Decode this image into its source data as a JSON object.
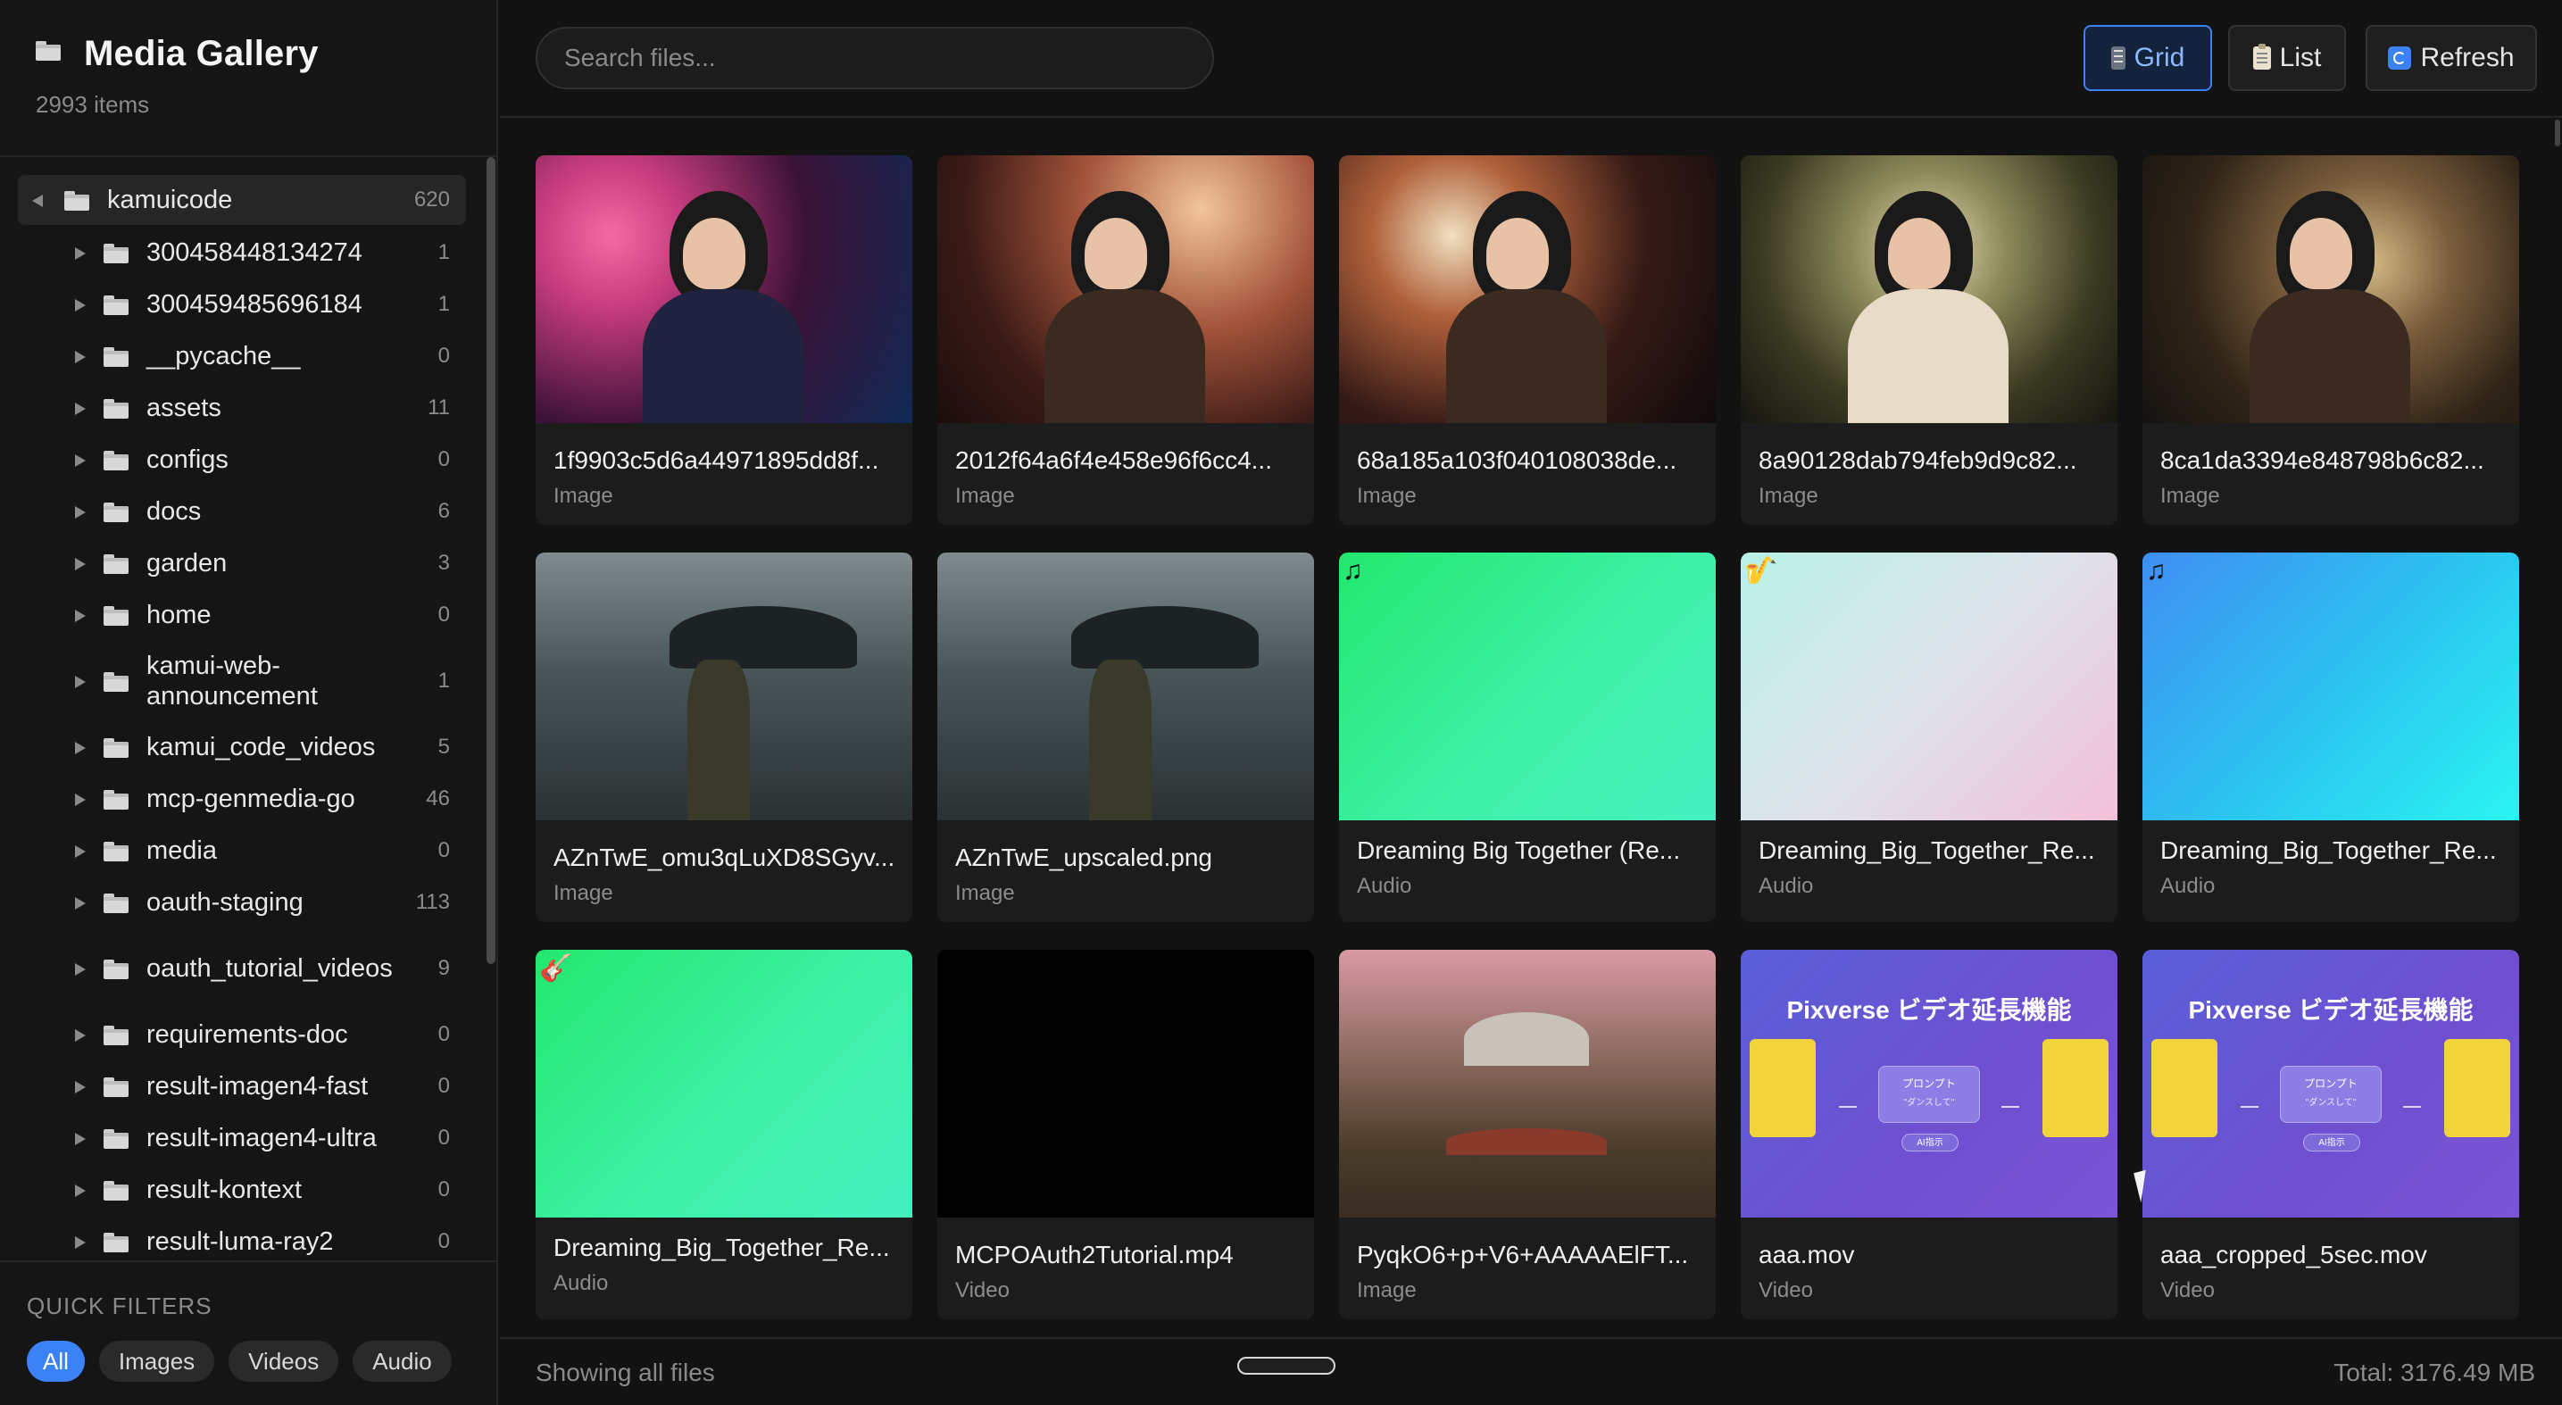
{
  "sidebar": {
    "title": "Media Gallery",
    "item_count": "2993 items",
    "root": {
      "name": "kamuicode",
      "count": "620"
    },
    "folders": [
      {
        "name": "300458448134274",
        "count": "1"
      },
      {
        "name": "300459485696184",
        "count": "1"
      },
      {
        "name": "__pycache__",
        "count": "0"
      },
      {
        "name": "assets",
        "count": "11"
      },
      {
        "name": "configs",
        "count": "0"
      },
      {
        "name": "docs",
        "count": "6"
      },
      {
        "name": "garden",
        "count": "3"
      },
      {
        "name": "home",
        "count": "0"
      },
      {
        "name": "kamui-web-announcement",
        "count": "1"
      },
      {
        "name": "kamui_code_videos",
        "count": "5"
      },
      {
        "name": "mcp-genmedia-go",
        "count": "46"
      },
      {
        "name": "media",
        "count": "0"
      },
      {
        "name": "oauth-staging",
        "count": "113"
      },
      {
        "name": "oauth_tutorial_videos",
        "count": "9"
      },
      {
        "name": "requirements-doc",
        "count": "0"
      },
      {
        "name": "result-imagen4-fast",
        "count": "0"
      },
      {
        "name": "result-imagen4-ultra",
        "count": "0"
      },
      {
        "name": "result-kontext",
        "count": "0"
      },
      {
        "name": "result-luma-ray2",
        "count": "0"
      }
    ],
    "quick_filters": {
      "heading": "QUICK FILTERS",
      "chips": [
        "All",
        "Images",
        "Videos",
        "Audio"
      ],
      "active": "All"
    }
  },
  "toolbar": {
    "search_placeholder": "Search files...",
    "grid_label": "Grid",
    "list_label": "List",
    "refresh_label": "Refresh",
    "active_view": "Grid"
  },
  "files": [
    {
      "name": "1f9903c5d6a44971895dd8f...",
      "type": "Image",
      "thumb": "concert1"
    },
    {
      "name": "2012f64a6f4e458e96f6cc4...",
      "type": "Image",
      "thumb": "concert2"
    },
    {
      "name": "68a185a103f040108038de...",
      "type": "Image",
      "thumb": "concert3"
    },
    {
      "name": "8a90128dab794feb9d9c82...",
      "type": "Image",
      "thumb": "concert4"
    },
    {
      "name": "8ca1da3394e848798b6c82...",
      "type": "Image",
      "thumb": "concert5"
    },
    {
      "name": "AZnTwE_omu3qLuXD8SGyv...",
      "type": "Image",
      "thumb": "rain"
    },
    {
      "name": "AZnTwE_upscaled.png",
      "type": "Image",
      "thumb": "rain"
    },
    {
      "name": "Dreaming Big Together (Re...",
      "type": "Audio",
      "thumb": "green",
      "badge": "music-note"
    },
    {
      "name": "Dreaming_Big_Together_Re...",
      "type": "Audio",
      "thumb": "pastel",
      "badge": "saxophone"
    },
    {
      "name": "Dreaming_Big_Together_Re...",
      "type": "Audio",
      "thumb": "bluecyan",
      "badge": "music-note"
    },
    {
      "name": "Dreaming_Big_Together_Re...",
      "type": "Audio",
      "thumb": "green",
      "badge": "guitar"
    },
    {
      "name": "MCPOAuth2Tutorial.mp4",
      "type": "Video",
      "thumb": "black"
    },
    {
      "name": "PyqkO6+p+V6+AAAAAElFT...",
      "type": "Image",
      "thumb": "sakura"
    },
    {
      "name": "aaa.mov",
      "type": "Video",
      "thumb": "pix"
    },
    {
      "name": "aaa_cropped_5sec.mov",
      "type": "Video",
      "thumb": "pix"
    }
  ],
  "pix_thumb": {
    "title": "Pixverse ビデオ延長機能",
    "box_label": "プロンプト",
    "box_sub": "\"ダンスして\"",
    "ai_label": "AI指示"
  },
  "footer": {
    "status": "Showing all files",
    "total": "Total: 3176.49 MB"
  },
  "colors": {
    "accent": "#3b82f6",
    "background": "#121212",
    "card": "#1c1c1c"
  }
}
